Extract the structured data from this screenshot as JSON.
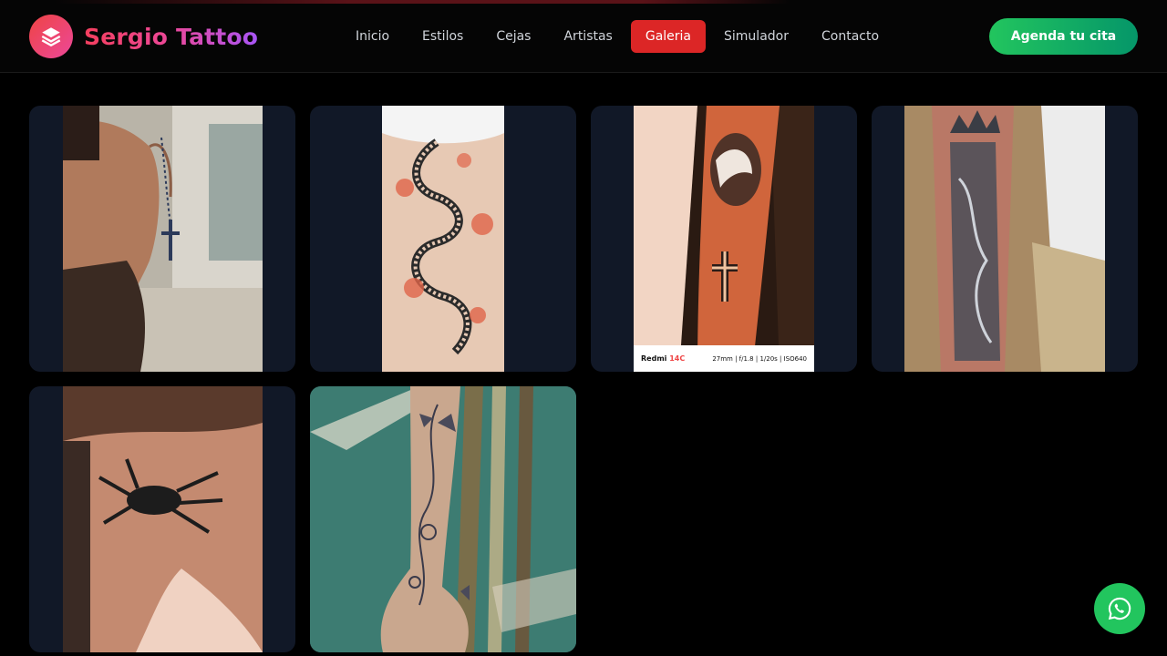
{
  "brand": {
    "name": "Sergio Tattoo",
    "logo_icon": "layers-icon"
  },
  "nav": {
    "items": [
      {
        "label": "Inicio",
        "active": false
      },
      {
        "label": "Estilos",
        "active": false
      },
      {
        "label": "Cejas",
        "active": false
      },
      {
        "label": "Artistas",
        "active": false
      },
      {
        "label": "Galeria",
        "active": true
      },
      {
        "label": "Simulador",
        "active": false
      },
      {
        "label": "Contacto",
        "active": false
      }
    ]
  },
  "cta": {
    "label": "Agenda tu cita"
  },
  "gallery": {
    "items": [
      {
        "subject": "rosary cross shoulder tattoo"
      },
      {
        "subject": "dragon back tattoo"
      },
      {
        "subject": "dove and cross forearm tattoo",
        "caption": {
          "device": "Redmi",
          "model": "14C",
          "specs": "27mm | f/1.8 | 1/20s | ISO640"
        }
      },
      {
        "subject": "crown forearm tattoo"
      },
      {
        "subject": "spider tattoo"
      },
      {
        "subject": "butterfly floral ankle tattoo"
      }
    ]
  },
  "whatsapp": {
    "icon": "whatsapp-icon"
  },
  "colors": {
    "active_nav": "#dc2626",
    "cta": "#22c55e",
    "card_bg": "#111827"
  }
}
